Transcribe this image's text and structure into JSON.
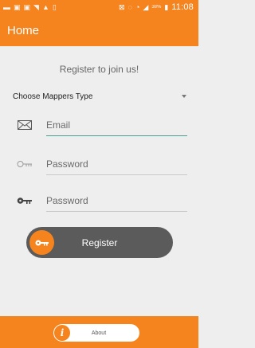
{
  "status_bar": {
    "battery": "38%",
    "time": "11:08"
  },
  "app_bar": {
    "title": "Home"
  },
  "form": {
    "heading": "Register to join us!",
    "mapper_type": {
      "selected": "Choose Mappers Type"
    },
    "email": {
      "placeholder": "Email",
      "icon": "envelope-icon"
    },
    "password": {
      "placeholder": "Password",
      "icon": "key-outline-icon"
    },
    "confirm_password": {
      "placeholder": "Password",
      "icon": "key-icon"
    },
    "register_button": {
      "label": "Register",
      "icon": "key-icon"
    }
  },
  "bottom_bar": {
    "about_button": {
      "label": "About",
      "icon": "info-icon"
    }
  },
  "colors": {
    "primary": "#f5841f",
    "button_dark": "#5b5b5b",
    "active_underline": "#4c9e92",
    "background": "#eeeeee"
  }
}
